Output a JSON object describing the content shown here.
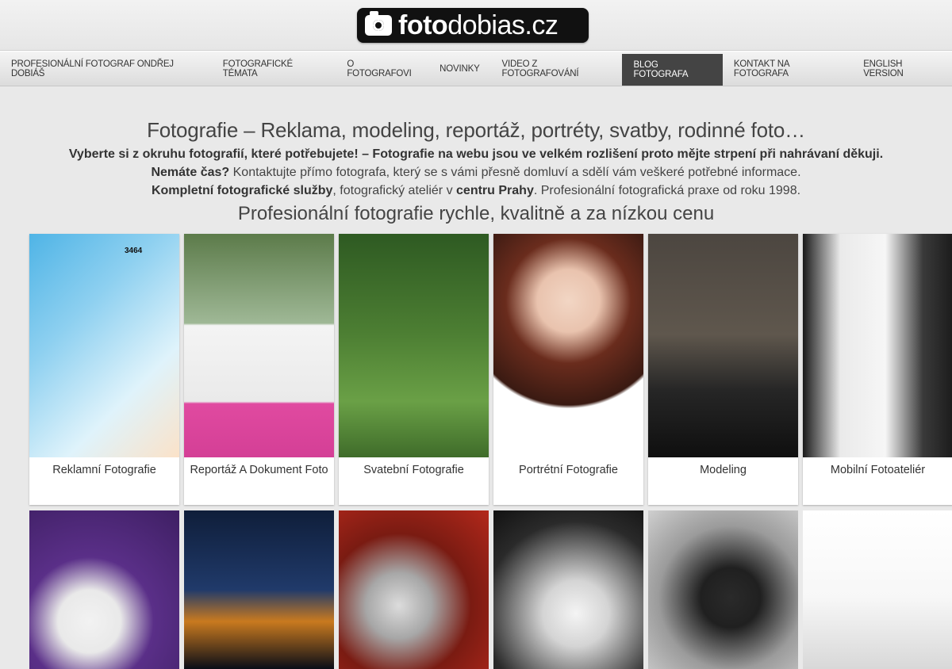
{
  "header": {
    "logo": {
      "text_bold": "foto",
      "text_light": "dobias.cz"
    }
  },
  "nav": {
    "items": [
      {
        "label": "PROFESIONÁLNÍ FOTOGRAF ONDŘEJ DOBIÁŠ"
      },
      {
        "label": "FOTOGRAFICKÉ TÉMATA"
      },
      {
        "label": "O FOTOGRAFOVI"
      },
      {
        "label": "NOVINKY"
      },
      {
        "label": "VIDEO Z FOTOGRAFOVÁNÍ"
      },
      {
        "label": "BLOG FOTOGRAFA",
        "active": true
      },
      {
        "label": "KONTAKT NA FOTOGRAFA"
      },
      {
        "label": "ENGLISH VERSION"
      }
    ]
  },
  "intro": {
    "headline": "Fotografie – Reklama, modeling, reportáž, portréty, svatby, rodinné foto…",
    "line1": "Vyberte si z okruhu fotografií, které potřebujete! – Fotografie na webu jsou ve velkém rozlišení proto mějte strpení při nahrávaní děkuji.",
    "line2_bold": "Nemáte čas?",
    "line2_rest": " Kontaktujte přímo fotografa, který se s vámi přesně domluví a sdělí vám veškeré potřebné informace.",
    "line3_bold1": "Kompletní fotografické služby",
    "line3_mid": ", fotografický ateliér v ",
    "line3_bold2": "centru Prahy",
    "line3_end": ". Profesionální fotografická praxe od roku 1998.",
    "subhead": "Profesionální fotografie rychle, kvalitně a za nízkou cenu"
  },
  "gallery": {
    "row1": [
      {
        "caption": "Reklamní Fotografie"
      },
      {
        "caption": "Reportáž A Dokument Foto"
      },
      {
        "caption": "Svatební Fotografie"
      },
      {
        "caption": "Portrétní Fotografie"
      },
      {
        "caption": "Modeling"
      },
      {
        "caption": "Mobilní Fotoateliér"
      }
    ],
    "row1_badge": "3464"
  }
}
